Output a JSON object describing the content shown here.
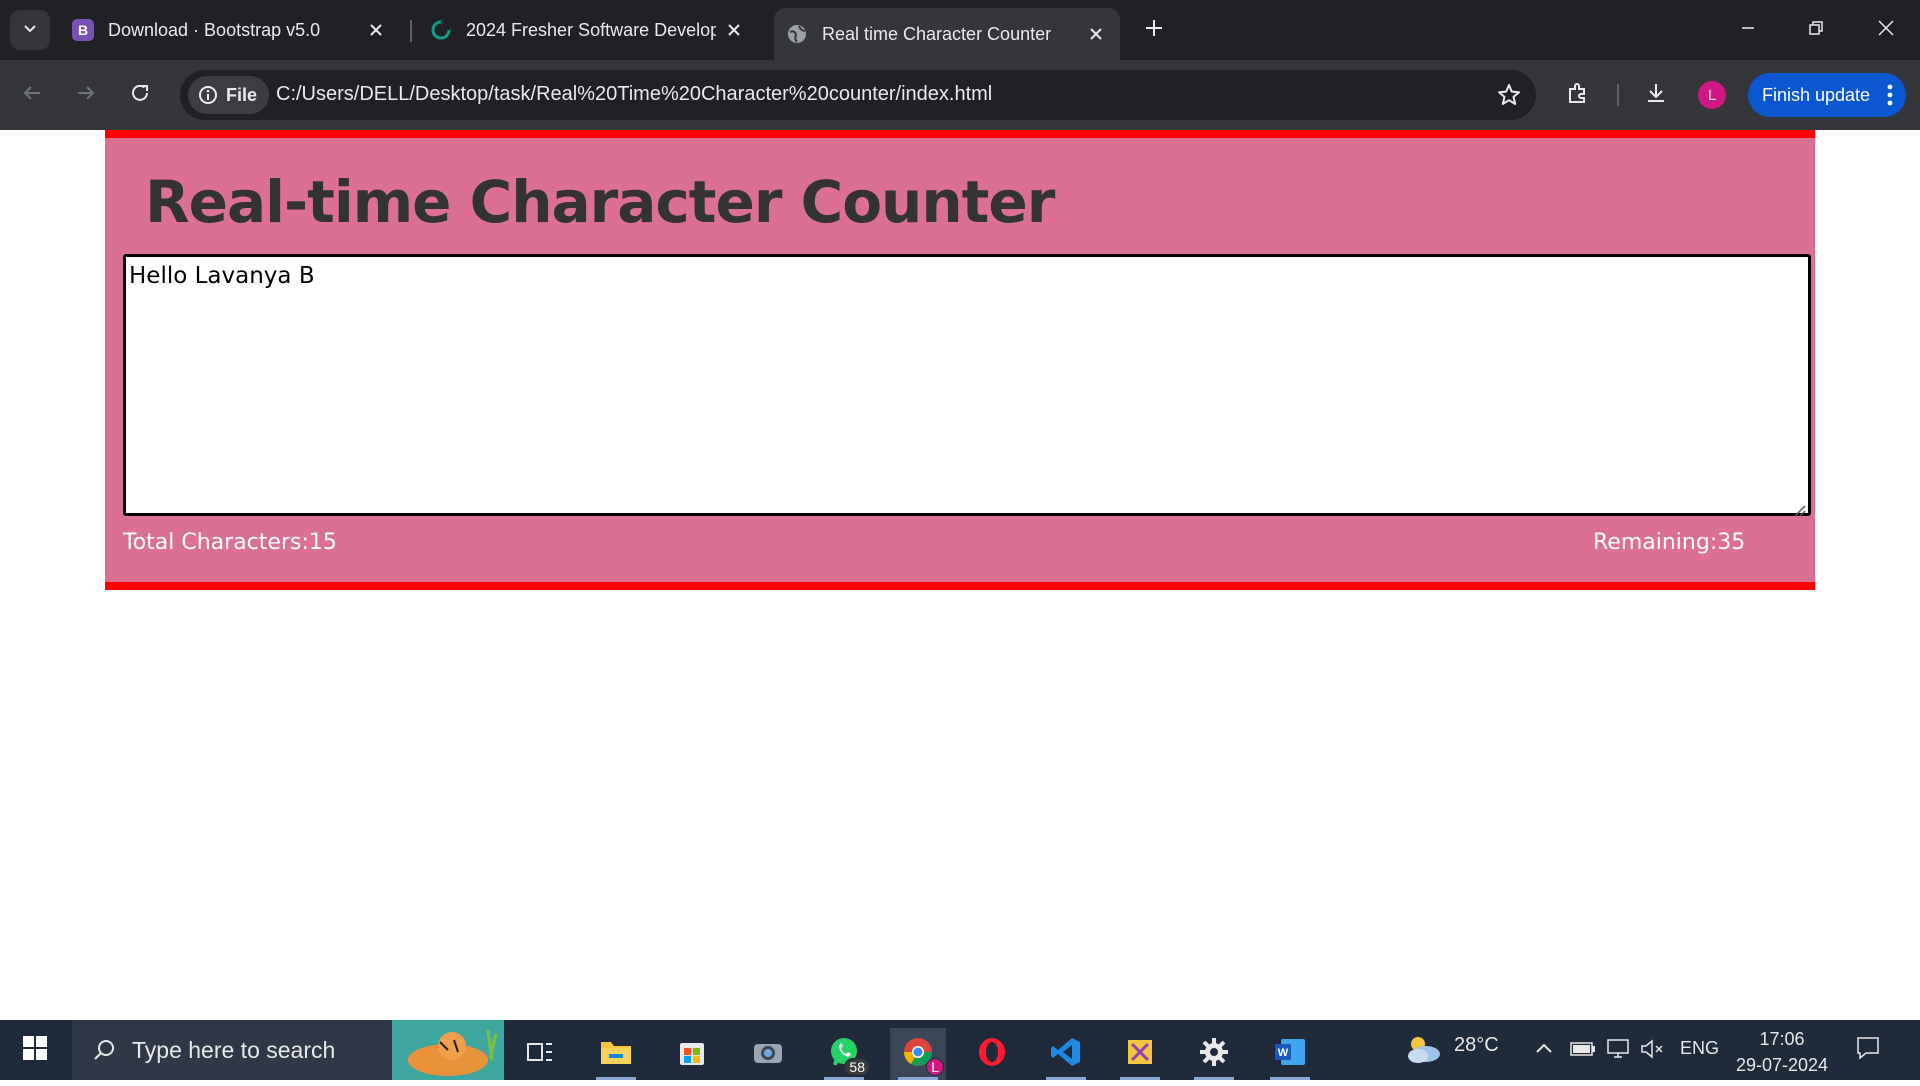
{
  "browser": {
    "tabs": [
      {
        "title": "Download · Bootstrap v5.0",
        "icon": "bootstrap-icon",
        "active": false
      },
      {
        "title": "2024 Fresher Software Develop",
        "icon": "site-icon",
        "active": false
      },
      {
        "title": "Real time Character Counter",
        "icon": "globe-icon",
        "active": true
      }
    ],
    "site_chip_label": "File",
    "url": "C:/Users/DELL/Desktop/task/Real%20Time%20Character%20counter/index.html",
    "profile_initial": "L",
    "finish_update_label": "Finish update",
    "accent_color": "#0b57d0"
  },
  "page": {
    "heading": "Real-time Character Counter",
    "textarea_value": "Hello Lavanya B",
    "total_characters_label": "Total Characters:15",
    "remaining_label": "Remaining:35",
    "card_color": "#db7093",
    "border_color": "#ff0000"
  },
  "taskbar": {
    "search_placeholder": "Type here to search",
    "whatsapp_badge": "58",
    "chrome_badge": "L",
    "weather_temp": "28°C",
    "language": "ENG",
    "time": "17:06",
    "date": "29-07-2024"
  }
}
